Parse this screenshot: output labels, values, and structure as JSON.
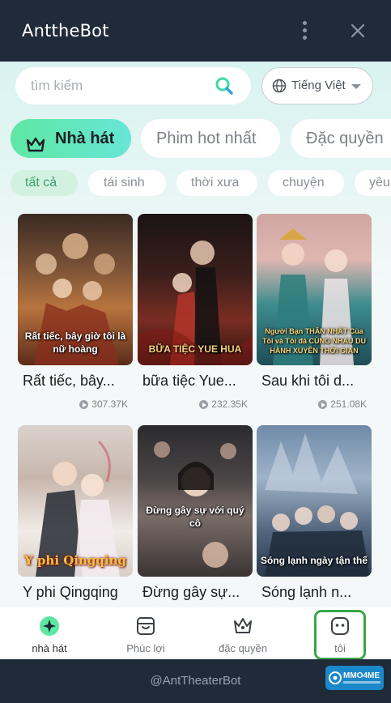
{
  "window": {
    "title": "AnttheBot",
    "menu_icon": "kebab-menu-icon",
    "close_icon": "close-icon"
  },
  "search": {
    "placeholder": "tìm kiếm",
    "value": "",
    "icon": "search-icon"
  },
  "language": {
    "label": "Tiếng Việt",
    "icon": "globe-icon"
  },
  "category_tabs": [
    {
      "label": "Nhà hát",
      "active": true,
      "icon": "crown-icon"
    },
    {
      "label": "Phim hot nhất",
      "active": false
    },
    {
      "label": "Đặc quyền",
      "active": false
    }
  ],
  "genre_chips": [
    {
      "label": "tất cả",
      "active": true
    },
    {
      "label": "tái sinh",
      "active": false
    },
    {
      "label": "thời xưa",
      "active": false
    },
    {
      "label": "chuyện",
      "active": false
    },
    {
      "label": "yêu",
      "active": false
    }
  ],
  "dramas": [
    {
      "title": "Rất tiếc, bây...",
      "views": "307.37K",
      "poster_caption": "Rất tiếc, bây giờ tôi là nữ hoàng"
    },
    {
      "title": "bữa tiệc Yue...",
      "views": "232.35K",
      "poster_caption": "BỮA TIỆC YUE HUA"
    },
    {
      "title": "Sau khi tôi d...",
      "views": "251.08K",
      "poster_caption": "Người Bạn THÂN NHẤT Của Tôi và Tôi đã CÙNG NHAU DU HÀNH XUYÊN THỜI GIAN"
    },
    {
      "title": "Y phi Qingqing",
      "views": "",
      "poster_caption": "Y phi Qingqing"
    },
    {
      "title": "Đừng gây sự...",
      "views": "",
      "poster_caption": "Đừng gây sự với quý cô"
    },
    {
      "title": "Sóng lạnh n...",
      "views": "",
      "poster_caption": "Sóng lạnh ngày tận thế"
    }
  ],
  "bottom_nav": [
    {
      "label": "nhà hát",
      "icon": "theater-icon",
      "active": true
    },
    {
      "label": "Phúc lợi",
      "icon": "gift-box-icon",
      "active": false
    },
    {
      "label": "đặc quyền",
      "icon": "crown-icon",
      "active": false
    },
    {
      "label": "tôi",
      "icon": "profile-icon",
      "active": false
    }
  ],
  "footer": {
    "handle": "@AntTheaterBot"
  },
  "watermark": {
    "text": "MMO4ME"
  },
  "colors": {
    "accent_green": "#5ee7a4",
    "accent_teal": "#67e6d6",
    "window_dark": "#1f2b39",
    "highlight_box": "#3aa74a"
  }
}
